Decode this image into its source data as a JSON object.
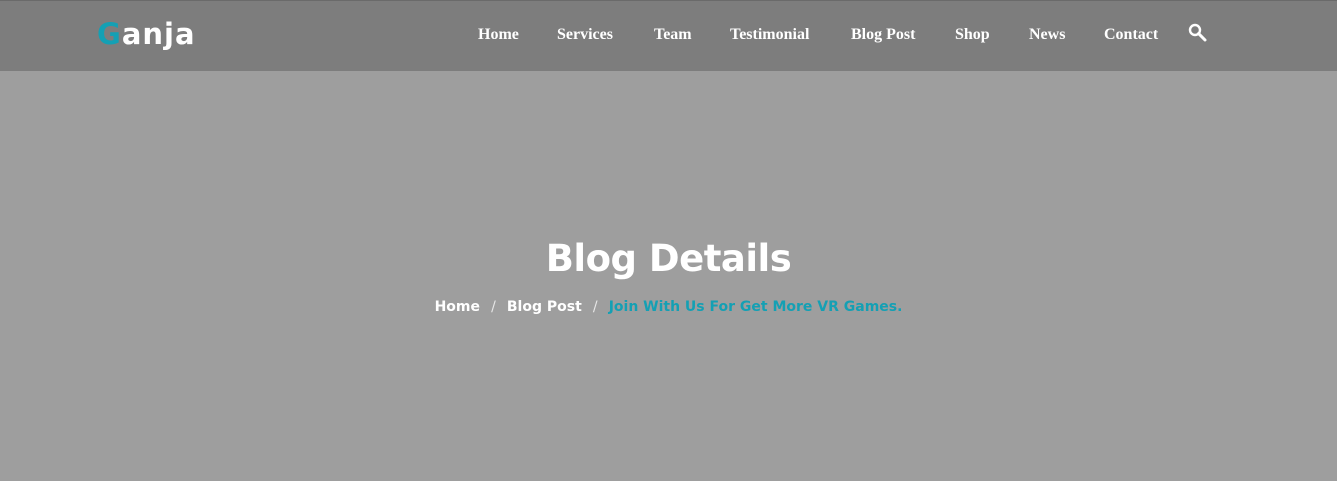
{
  "header": {
    "logo": {
      "accent_letter": "G",
      "rest": "anja"
    },
    "nav": [
      {
        "label": "Home"
      },
      {
        "label": "Services"
      },
      {
        "label": "Team"
      },
      {
        "label": "Testimonial"
      },
      {
        "label": "Blog Post"
      },
      {
        "label": "Shop"
      },
      {
        "label": "News"
      },
      {
        "label": "Contact"
      }
    ],
    "search_icon": "search-icon"
  },
  "hero": {
    "title": "Blog Details",
    "breadcrumb": {
      "home": "Home",
      "blog": "Blog Post",
      "separator": "/",
      "current": "Join With Us For Get More VR Games."
    }
  },
  "colors": {
    "accent": "#14a0b4",
    "header_bg": "#7d7d7d",
    "page_bg": "#9e9e9e",
    "text": "#ffffff"
  }
}
